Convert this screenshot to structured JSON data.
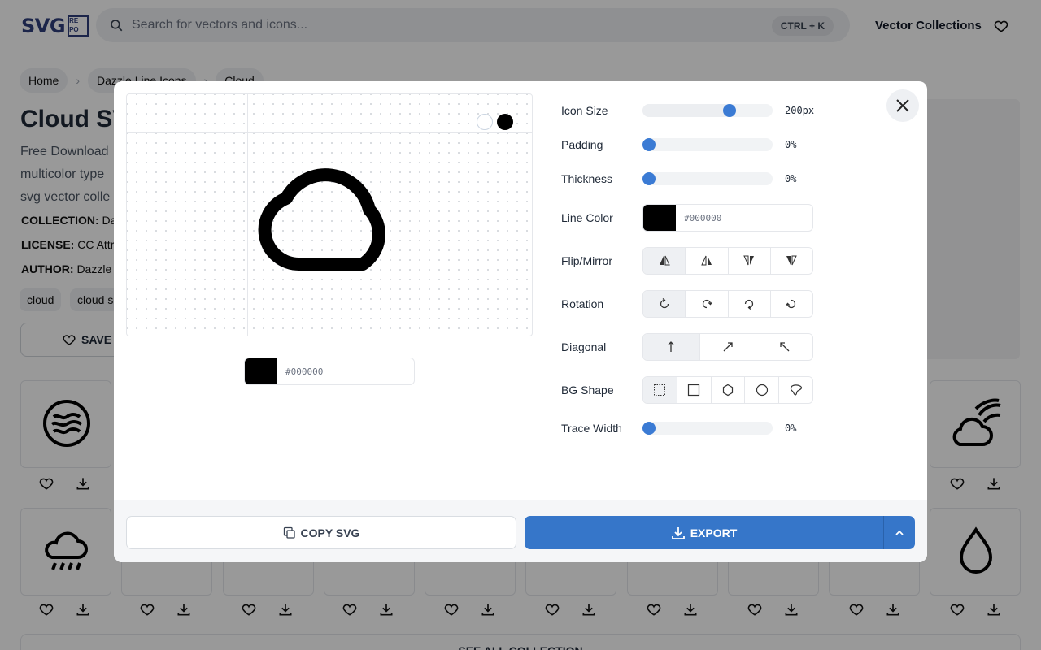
{
  "header": {
    "logo_text": "SVG",
    "logo_grid": [
      "RE",
      "PO"
    ],
    "search_placeholder": "Search for vectors and icons...",
    "search_shortcut": "CTRL + K",
    "nav_link": "Vector Collections"
  },
  "breadcrumb": [
    "Home",
    "Dazzle Line Icons",
    "Cloud"
  ],
  "page": {
    "title": "Cloud SV",
    "description_lines": [
      "Free Download",
      "multicolor type",
      "svg vector colle"
    ],
    "collection_label": "COLLECTION:",
    "collection_value": "Da",
    "license_label": "LICENSE:",
    "license_value": "CC Attr",
    "author_label": "AUTHOR:",
    "author_value": "Dazzle",
    "tags": [
      "cloud",
      "cloud s"
    ],
    "save_label": "SAVE",
    "see_all": "SEE ALL COLLECTION"
  },
  "modal": {
    "preview_color": "#000000",
    "controls": {
      "icon_size": {
        "label": "Icon Size",
        "value": "200px",
        "fraction": 0.69
      },
      "padding": {
        "label": "Padding",
        "value": "0%",
        "fraction": 0
      },
      "thickness": {
        "label": "Thickness",
        "value": "0%",
        "fraction": 0
      },
      "line_color": {
        "label": "Line Color",
        "value": "#000000"
      },
      "flip": {
        "label": "Flip/Mirror"
      },
      "rotation": {
        "label": "Rotation"
      },
      "diagonal": {
        "label": "Diagonal"
      },
      "bg_shape": {
        "label": "BG Shape"
      },
      "trace_width": {
        "label": "Trace Width",
        "value": "0%",
        "fraction": 0
      }
    },
    "copy_label": "COPY SVG",
    "export_label": "EXPORT"
  },
  "colors": {
    "accent": "#3676c9",
    "thumb": "#3b7bd4",
    "icon": "#000000"
  }
}
